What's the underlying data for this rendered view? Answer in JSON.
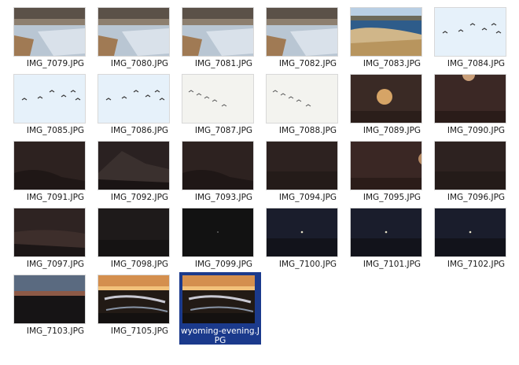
{
  "files": [
    {
      "name": "IMG_7079.JPG",
      "thumbnail": "river-snow-bank"
    },
    {
      "name": "IMG_7080.JPG",
      "thumbnail": "river-snow-bank"
    },
    {
      "name": "IMG_7081.JPG",
      "thumbnail": "river-snow-bank"
    },
    {
      "name": "IMG_7082.JPG",
      "thumbnail": "river-snow-bank"
    },
    {
      "name": "IMG_7083.JPG",
      "thumbnail": "lake-dry-grass"
    },
    {
      "name": "IMG_7084.JPG",
      "thumbnail": "geese-in-sky"
    },
    {
      "name": "IMG_7085.JPG",
      "thumbnail": "geese-in-sky"
    },
    {
      "name": "IMG_7086.JPG",
      "thumbnail": "geese-in-sky"
    },
    {
      "name": "IMG_7087.JPG",
      "thumbnail": "geese-pale-sky"
    },
    {
      "name": "IMG_7088.JPG",
      "thumbnail": "geese-pale-sky"
    },
    {
      "name": "IMG_7089.JPG",
      "thumbnail": "full-moon-dusk"
    },
    {
      "name": "IMG_7090.JPG",
      "thumbnail": "moon-top-dusk"
    },
    {
      "name": "IMG_7091.JPG",
      "thumbnail": "dark-hills"
    },
    {
      "name": "IMG_7092.JPG",
      "thumbnail": "dark-ridge"
    },
    {
      "name": "IMG_7093.JPG",
      "thumbnail": "dark-hills"
    },
    {
      "name": "IMG_7094.JPG",
      "thumbnail": "dark-plain"
    },
    {
      "name": "IMG_7095.JPG",
      "thumbnail": "moon-edge-dusk"
    },
    {
      "name": "IMG_7096.JPG",
      "thumbnail": "dark-plain"
    },
    {
      "name": "IMG_7097.JPG",
      "thumbnail": "dark-ridge-light"
    },
    {
      "name": "IMG_7098.JPG",
      "thumbnail": "night-dark"
    },
    {
      "name": "IMG_7099.JPG",
      "thumbnail": "night-black"
    },
    {
      "name": "IMG_7100.JPG",
      "thumbnail": "night-blue-star"
    },
    {
      "name": "IMG_7101.JPG",
      "thumbnail": "night-blue-star"
    },
    {
      "name": "IMG_7102.JPG",
      "thumbnail": "night-blue-star"
    },
    {
      "name": "IMG_7103.JPG",
      "thumbnail": "sunset-horizon"
    },
    {
      "name": "IMG_7105.JPG",
      "thumbnail": "sunset-water"
    },
    {
      "name": "wyoming-evening.JPG",
      "thumbnail": "sunset-water",
      "selected": true
    }
  ],
  "colors": {
    "selection": "#1b3a8c"
  }
}
